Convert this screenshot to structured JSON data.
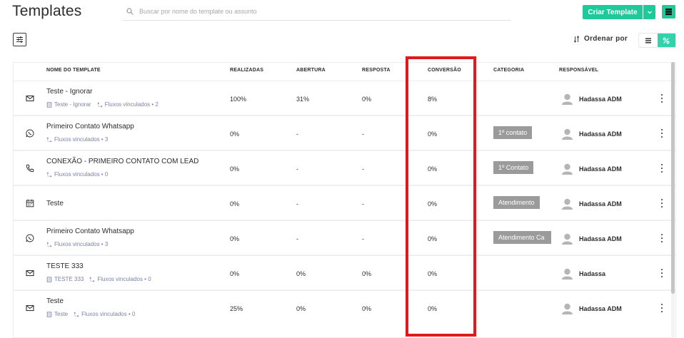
{
  "page": {
    "title": "Templates",
    "search_placeholder": "Buscar por nome do template ou assunto",
    "create_label": "Criar Template",
    "sort_label": "Ordenar por"
  },
  "colors": {
    "accent": "#1ec99a",
    "tag": "#9b9b9b",
    "highlight": "#e01a1a",
    "sub_text": "#7d82a6"
  },
  "table": {
    "headers": {
      "name": "NOME DO TEMPLATE",
      "done": "REALIZADAS",
      "open": "ABERTURA",
      "reply": "RESPOSTA",
      "conv": "CONVERSÃO",
      "cat": "CATEGORIA",
      "owner": "RESPONSÁVEL"
    },
    "rows": [
      {
        "icon": "mail-icon",
        "name": "Teste - Ignorar",
        "template_ref": "Teste - Ignorar",
        "flows": "Fluxos vinculados • 2",
        "done": "100%",
        "open": "31%",
        "reply": "0%",
        "conv": "8%",
        "cat": "",
        "owner": "Hadassa ADM"
      },
      {
        "icon": "whatsapp-icon",
        "name": "Primeiro Contato Whatsapp",
        "template_ref": "",
        "flows": "Fluxos vinculados • 3",
        "done": "0%",
        "open": "-",
        "reply": "-",
        "conv": "0%",
        "cat": "1º contato",
        "owner": "Hadassa ADM"
      },
      {
        "icon": "phone-icon",
        "name": "CONEXÃO - PRIMEIRO CONTATO COM LEAD",
        "template_ref": "",
        "flows": "Fluxos vinculados • 0",
        "done": "0%",
        "open": "-",
        "reply": "-",
        "conv": "0%",
        "cat": "1º Contato",
        "owner": "Hadassa ADM"
      },
      {
        "icon": "calendar-icon",
        "name": "Teste",
        "template_ref": "",
        "flows": "",
        "done": "0%",
        "open": "-",
        "reply": "-",
        "conv": "0%",
        "cat": "Atendimento",
        "owner": "Hadassa ADM"
      },
      {
        "icon": "whatsapp-icon",
        "name": "Primeiro Contato Whatsapp",
        "template_ref": "",
        "flows": "Fluxos vinculados • 3",
        "done": "0%",
        "open": "-",
        "reply": "-",
        "conv": "0%",
        "cat": "Atendimento Ca",
        "owner": "Hadassa ADM"
      },
      {
        "icon": "mail-icon",
        "name": "TESTE 333",
        "template_ref": "TESTE 333",
        "flows": "Fluxos vinculados • 0",
        "done": "0%",
        "open": "0%",
        "reply": "0%",
        "conv": "0%",
        "cat": "",
        "owner": "Hadassa"
      },
      {
        "icon": "mail-icon",
        "name": "Teste",
        "template_ref": "Teste",
        "flows": "Fluxos vinculados • 0",
        "done": "25%",
        "open": "0%",
        "reply": "0%",
        "conv": "0%",
        "cat": "",
        "owner": "Hadassa ADM"
      }
    ]
  }
}
